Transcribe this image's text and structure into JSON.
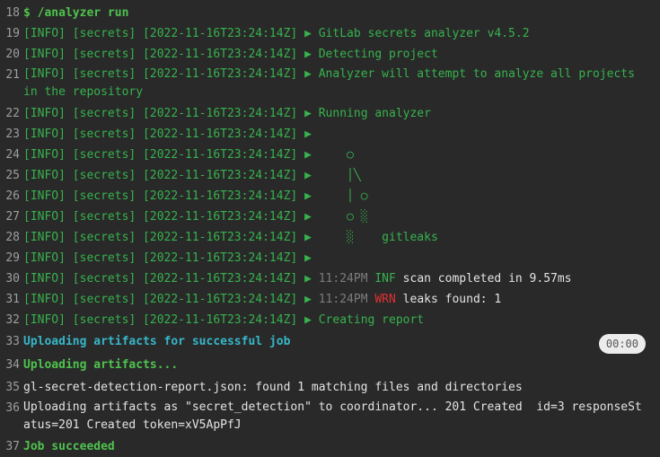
{
  "lines": [
    {
      "n": "18",
      "text": "$ /analyzer run"
    },
    {
      "n": "19",
      "prefix": "[INFO] [secrets] [2022-11-16T23:24:14Z] ▶ ",
      "text": "GitLab secrets analyzer v4.5.2"
    },
    {
      "n": "20",
      "prefix": "[INFO] [secrets] [2022-11-16T23:24:14Z] ▶ ",
      "text": "Detecting project"
    },
    {
      "n": "21",
      "prefix": "[INFO] [secrets] [2022-11-16T23:24:14Z] ▶ ",
      "text": "Analyzer will attempt to analyze all projects in the repository"
    },
    {
      "n": "22",
      "prefix": "[INFO] [secrets] [2022-11-16T23:24:14Z] ▶ ",
      "text": "Running analyzer"
    },
    {
      "n": "23",
      "prefix": "[INFO] [secrets] [2022-11-16T23:24:14Z] ▶ ",
      "text": ""
    },
    {
      "n": "24",
      "prefix": "[INFO] [secrets] [2022-11-16T23:24:14Z] ▶ ",
      "text": "    ○"
    },
    {
      "n": "25",
      "prefix": "[INFO] [secrets] [2022-11-16T23:24:14Z] ▶ ",
      "text": "    │╲"
    },
    {
      "n": "26",
      "prefix": "[INFO] [secrets] [2022-11-16T23:24:14Z] ▶ ",
      "text": "    │ ○"
    },
    {
      "n": "27",
      "prefix": "[INFO] [secrets] [2022-11-16T23:24:14Z] ▶ ",
      "text": "    ○ ░"
    },
    {
      "n": "28",
      "prefix": "[INFO] [secrets] [2022-11-16T23:24:14Z] ▶ ",
      "text": "    ░    gitleaks"
    },
    {
      "n": "29",
      "prefix": "[INFO] [secrets] [2022-11-16T23:24:14Z] ▶ ",
      "text": ""
    },
    {
      "n": "30",
      "prefix": "[INFO] [secrets] [2022-11-16T23:24:14Z] ▶ ",
      "time": "11:24PM",
      "level": "INF",
      "msg": "scan completed in 9.57ms"
    },
    {
      "n": "31",
      "prefix": "[INFO] [secrets] [2022-11-16T23:24:14Z] ▶ ",
      "time": "11:24PM",
      "level": "WRN",
      "msg": "leaks found: 1"
    },
    {
      "n": "32",
      "prefix": "[INFO] [secrets] [2022-11-16T23:24:14Z] ▶ ",
      "text": "Creating report"
    },
    {
      "n": "33",
      "text": "Uploading artifacts for successful job",
      "timer": "00:00"
    },
    {
      "n": "34",
      "text": "Uploading artifacts..."
    },
    {
      "n": "35",
      "text": "gl-secret-detection-report.json: found 1 matching files and directories"
    },
    {
      "n": "36",
      "text": "Uploading artifacts as \"secret_detection\" to coordinator... 201 Created  id=3 responseStatus=201 Created token=xV5ApPfJ"
    },
    {
      "n": "37",
      "text": "Job succeeded"
    }
  ],
  "colors": {
    "background": "#292929",
    "info_green": "#37b24d",
    "section_cyan": "#36b6c8",
    "warn_red": "#e03131"
  }
}
